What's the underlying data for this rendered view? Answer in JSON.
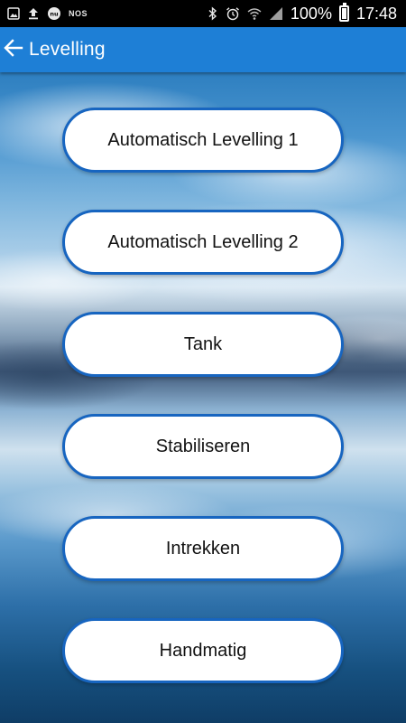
{
  "status_bar": {
    "notification_icons": [
      "gallery-icon",
      "upload-icon",
      "nu-icon",
      "nos-icon"
    ],
    "nos_label": "NOS",
    "system_icons": [
      "bluetooth-icon",
      "alarm-icon",
      "wifi-icon",
      "signal-icon"
    ],
    "battery_percent": "100%",
    "battery_icon": "battery-charging-icon",
    "time": "17:48"
  },
  "app_bar": {
    "title": "Levelling",
    "back_icon": "arrow-left-icon",
    "color": "#1e7fd6"
  },
  "menu": {
    "items": [
      {
        "label": "Automatisch Levelling 1"
      },
      {
        "label": "Automatisch Levelling 2"
      },
      {
        "label": "Tank"
      },
      {
        "label": "Stabiliseren"
      },
      {
        "label": "Intrekken"
      },
      {
        "label": "Handmatig"
      }
    ],
    "button_border_color": "#1765c0",
    "button_fill_color": "#ffffff"
  }
}
